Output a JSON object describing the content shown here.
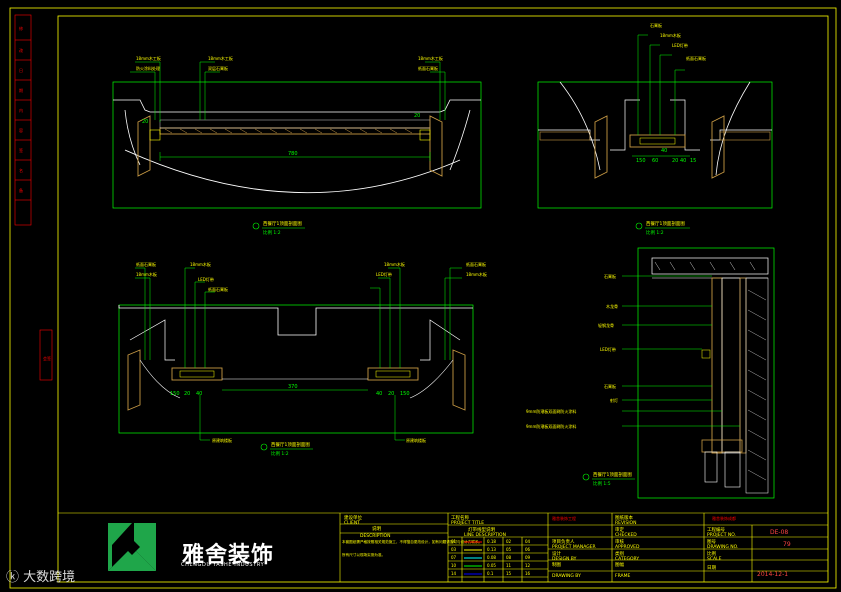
{
  "company": {
    "name_cn": "雅舍装饰",
    "name_en": "CHENGDU YASHE INDUSTRY",
    "logo_color": "#1fa64a"
  },
  "watermark": "大数跨境",
  "views": [
    {
      "title": "西餐厅1顶面剖面图",
      "scale": "比例 1:2"
    },
    {
      "title": "西餐厅1顶面剖面图",
      "scale": "比例 1:2"
    },
    {
      "title": "西餐厅1顶面剖面图",
      "scale": "比例 1:2"
    },
    {
      "title": "西餐厅1顶面剖面图",
      "scale": "比例 1:5"
    }
  ],
  "dimensions": {
    "top_span": "780",
    "top_left_small": "20",
    "top_right_small": "20",
    "right_40": "40",
    "right_row": [
      "150",
      "60",
      "20",
      "40",
      "15"
    ],
    "bottom_span": "370",
    "bottom_left": [
      "150",
      "20",
      "40"
    ],
    "bottom_right": [
      "40",
      "20",
      "150"
    ]
  },
  "labels": {
    "top_left_a": "18mm木工板",
    "top_left_b": "防火涂料处理",
    "top_mid_a": "18mm木工板",
    "top_mid_b": "双层石膏板",
    "top_right_a": "18mm木工板",
    "top_right_b": "纸面石膏板",
    "right_top_a": "石膏板",
    "right_top_b": "18mm木板",
    "right_top_c": "LED灯带",
    "right_top_d": "纸面石膏板",
    "bl_a": "纸面石膏板",
    "bl_b": "18mm木板",
    "bl_c": "18mm木板",
    "bl_d": "LED灯带",
    "bl_e": "纸面石膏板",
    "br_a": "18mm木板",
    "br_b": "LED灯带",
    "br_c": "纸面石膏板",
    "br_d": "18mm木板",
    "bot_note_left": "原建筑楼板",
    "bot_note_right": "原建筑楼板",
    "detail_1": "石膏板",
    "detail_2": "木龙骨",
    "detail_3": "轻钢龙骨",
    "detail_4": "LED灯带",
    "detail_5": "石膏板",
    "detail_6": "射灯",
    "detail_7": "9mm防潮板双面刷防火涂料",
    "detail_8": "9mm防潮板双面刷防火涂料"
  },
  "title_block": {
    "client_cn": "建设单位",
    "client_en": "CLIENT",
    "desc_cn": "说明",
    "desc_en": "DESCRIPTION",
    "desc_text": [
      "本套图纸需严格按照相关规范施工，不得擅自更改设计，如有问题请及时与设计方联系。",
      "所有尺寸以现场实测为准。"
    ],
    "project_cn": "工程名称",
    "project_en": "PROJECT TITLE",
    "sheet_title_cn": "灯带线型说明",
    "sheet_title_en": "LINE DESCRIPTION",
    "line_rows": [
      [
        "01",
        "0.18",
        "02",
        "04"
      ],
      [
        "03",
        "0.13",
        "05",
        "06"
      ],
      [
        "07",
        "0.08",
        "08",
        "09"
      ],
      [
        "10",
        "0.05",
        "11",
        "12"
      ],
      [
        "14",
        "0.1",
        "15",
        "16"
      ]
    ],
    "company_mark": "雅舍装饰工程",
    "project_manager": "项目负责人",
    "project_manager_en": "PROJECT MANAGER",
    "design_cn": "设计",
    "design_en": "DESIGN BY",
    "drawing_cn": "制图",
    "drawing_en": "DRAWING BY",
    "approve_cn": "审定",
    "approve_en": "CHECKED",
    "approved_cn": "审核",
    "approved_en": "APPROVED",
    "category_cn": "类别",
    "category_en": "CATEGORY",
    "frame_cn": "图幅",
    "frame_en": "FRAME",
    "revision_cn": "图纸版本",
    "revision_en": "REVISION",
    "project_no_cn": "工程编号",
    "project_no_en": "PROJECT NO.",
    "project_no": "DE-08",
    "drawing_no_cn": "图号",
    "drawing_no_en": "DRAWING NO.",
    "drawing_no": "79",
    "scale_cn": "比例",
    "scale_en": "SCALE",
    "date_cn": "日期",
    "date": "2014-12-1",
    "stamp": "雅舍装饰成都"
  },
  "colors": {
    "frame": "#ffff00",
    "dimension": "#00ff00",
    "outline": "#ffffff",
    "wood": "#c89a44",
    "annotation": "#ff0000"
  }
}
